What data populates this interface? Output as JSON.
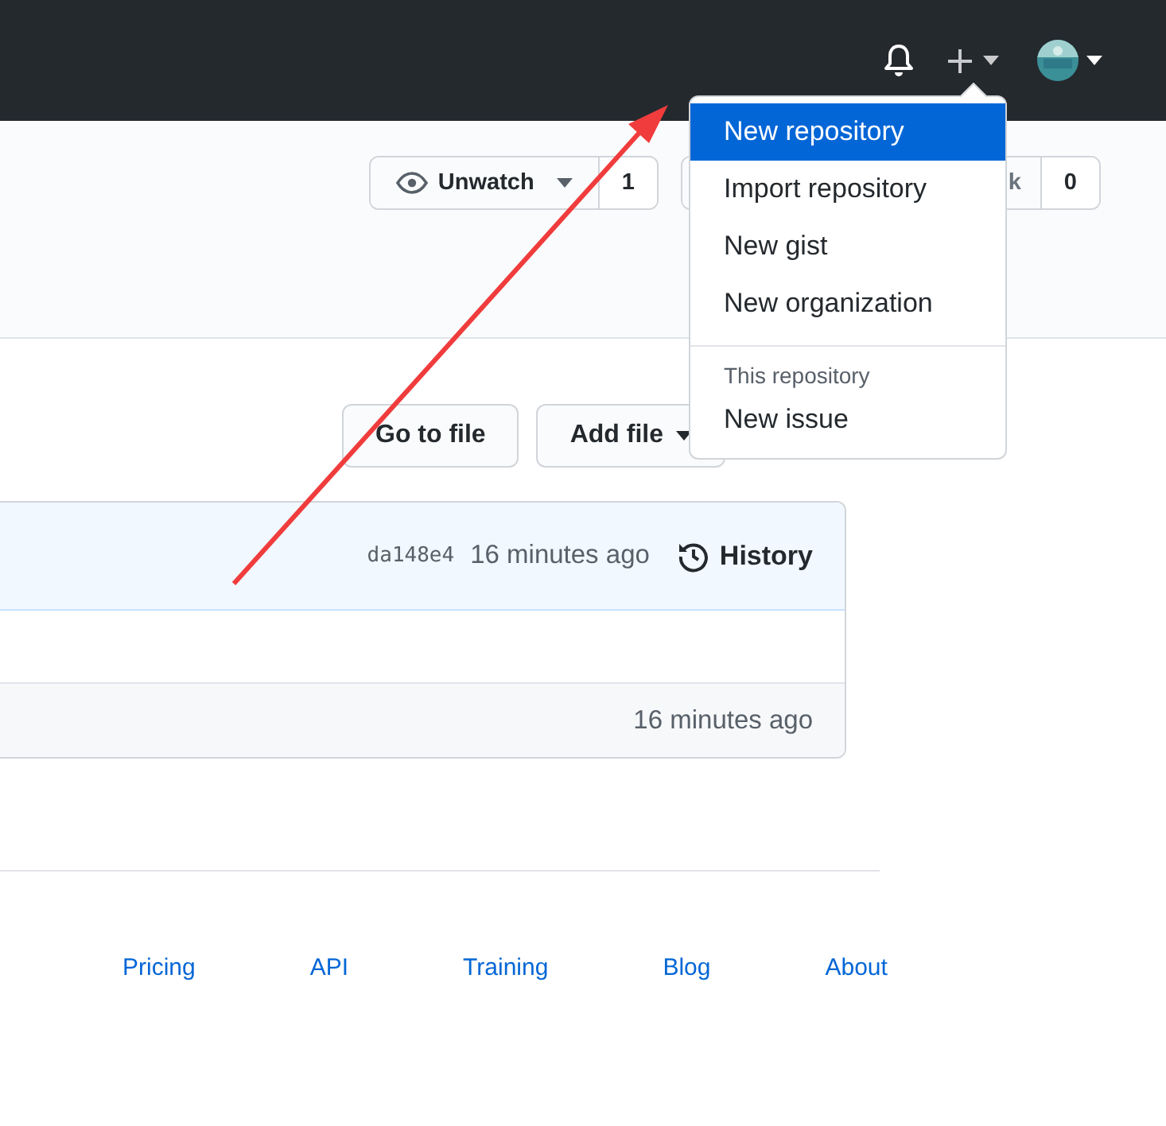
{
  "repo_actions": [
    {
      "label": "Unwatch",
      "count": "1",
      "caret": true
    },
    {
      "label": "k",
      "count": "0",
      "caret": false
    }
  ],
  "file_actions": [
    {
      "label": "Go to file",
      "caret": false
    },
    {
      "label": "Add file",
      "caret": true
    }
  ],
  "commit": {
    "sha": "da148e4",
    "time": "16 minutes ago",
    "history": "History"
  },
  "last_row_time": "16 minutes ago",
  "footer_links": [
    "Pricing",
    "API",
    "Training",
    "Blog",
    "About"
  ],
  "menu": {
    "items": [
      {
        "label": "New repository",
        "selected": true
      },
      {
        "label": "Import repository",
        "selected": false
      },
      {
        "label": "New gist",
        "selected": false
      },
      {
        "label": "New organization",
        "selected": false
      }
    ],
    "section": "This repository",
    "section_items": [
      {
        "label": "New issue",
        "selected": false
      }
    ]
  }
}
